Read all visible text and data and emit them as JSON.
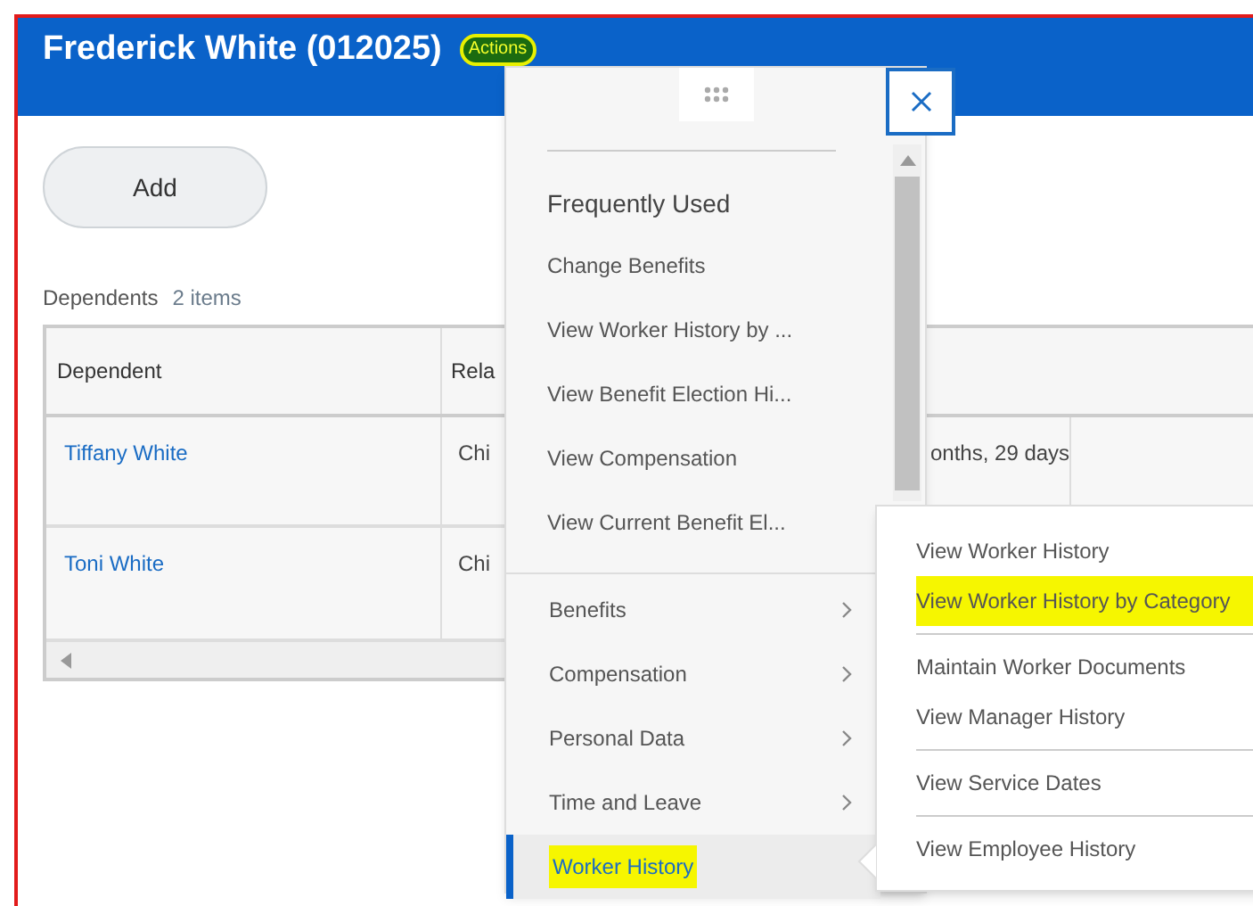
{
  "header": {
    "title": "Frederick White (012025)",
    "actions_button": {
      "label": "Actions",
      "highlighted": true
    }
  },
  "add_button": "Add",
  "dependents": {
    "title": "Dependents",
    "count": "2 items",
    "columns": [
      "Dependent",
      "Rela"
    ],
    "rows": [
      {
        "cells": [
          "Tiffany White",
          "Chi",
          "onths, 29 days"
        ]
      },
      {
        "cells": [
          "Toni White",
          "Chi"
        ]
      }
    ]
  },
  "actions_menu": {
    "section_title": "Frequently Used",
    "frequent_items": [
      "Change Benefits",
      "View Worker History by ...",
      "View Benefit Election Hi...",
      "View Compensation",
      "View Current Benefit El..."
    ],
    "categories": [
      {
        "label": "Benefits",
        "selected": false,
        "highlighted": false
      },
      {
        "label": "Compensation",
        "selected": false,
        "highlighted": false
      },
      {
        "label": "Personal Data",
        "selected": false,
        "highlighted": false
      },
      {
        "label": "Time and Leave",
        "selected": false,
        "highlighted": false
      },
      {
        "label": "Worker History",
        "selected": true,
        "highlighted": true
      }
    ]
  },
  "submenu": {
    "groups": [
      [
        {
          "label": "View Worker History",
          "highlighted": false
        },
        {
          "label": "View Worker History by Category",
          "highlighted": true
        }
      ],
      [
        {
          "label": "Maintain Worker Documents",
          "highlighted": false
        },
        {
          "label": "View Manager History",
          "highlighted": false
        }
      ],
      [
        {
          "label": "View Service Dates",
          "highlighted": false
        }
      ],
      [
        {
          "label": "View Employee History",
          "highlighted": false
        }
      ]
    ]
  }
}
